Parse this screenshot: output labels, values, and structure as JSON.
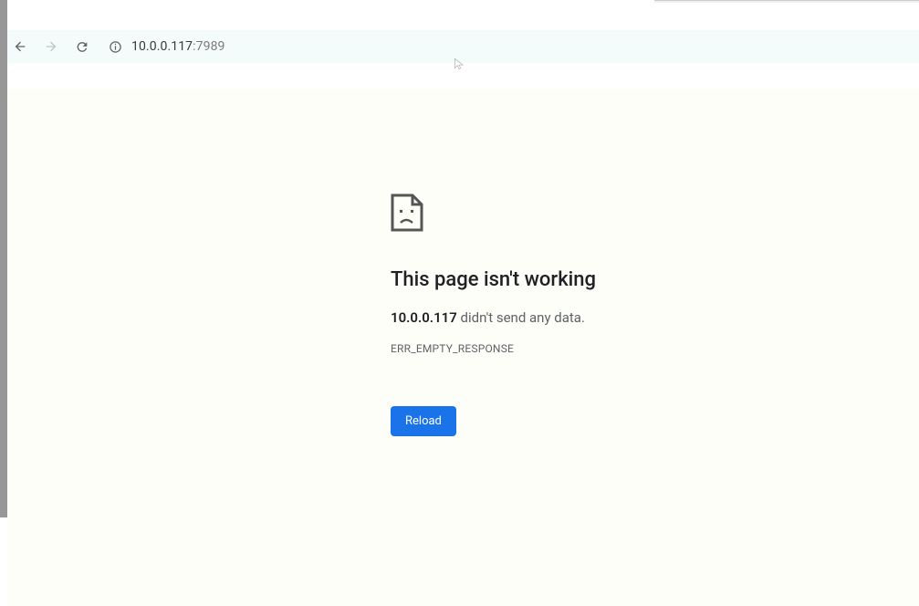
{
  "browser": {
    "url_host": "10.0.0.117",
    "url_port": ":7989"
  },
  "error": {
    "title": "This page isn't working",
    "host": "10.0.0.117",
    "message": " didn't send any data.",
    "code": "ERR_EMPTY_RESPONSE",
    "reload_label": "Reload"
  }
}
